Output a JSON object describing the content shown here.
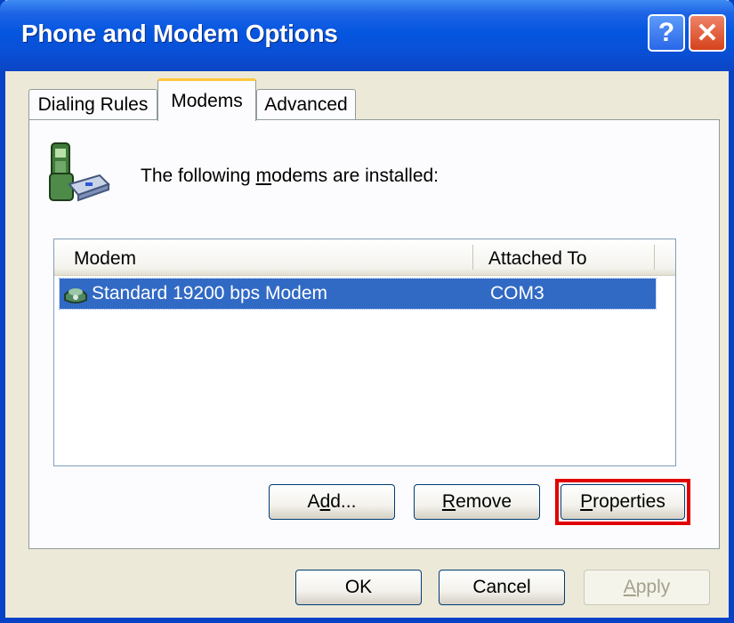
{
  "window": {
    "title": "Phone and Modem Options"
  },
  "titlebar_buttons": {
    "help": "?",
    "close": "✕"
  },
  "tabs": [
    {
      "label": "Dialing Rules",
      "selected": false
    },
    {
      "label": "Modems",
      "selected": true
    },
    {
      "label": "Advanced",
      "selected": false
    }
  ],
  "modems_tab": {
    "installed_prefix": "The following ",
    "installed_mnemonic": "m",
    "installed_suffix": "odems are  installed:",
    "columns": [
      "Modem",
      "Attached To"
    ],
    "rows": [
      {
        "modem": "Standard 19200 bps Modem",
        "attached_to": "COM3",
        "selected": true
      }
    ],
    "buttons": {
      "add_prefix": "A",
      "add_mnemonic": "d",
      "add_suffix": "d...",
      "remove_mnemonic": "R",
      "remove_suffix": "emove",
      "properties_mnemonic": "P",
      "properties_suffix": "roperties"
    }
  },
  "dialog_buttons": {
    "ok": "OK",
    "cancel": "Cancel",
    "apply_mnemonic": "A",
    "apply_suffix": "pply"
  },
  "colors": {
    "titlebar": "#0556E0",
    "selection": "#316AC5",
    "highlight": "#E00000",
    "face": "#ECE9D8"
  },
  "icons": [
    "help-icon",
    "close-icon",
    "phone-modem-icon",
    "modem-row-icon"
  ]
}
